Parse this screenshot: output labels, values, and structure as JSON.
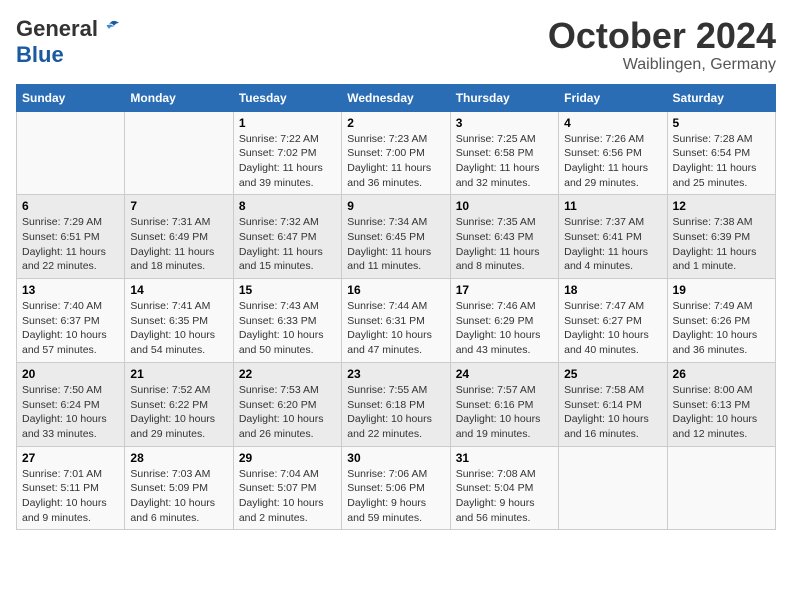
{
  "header": {
    "logo_line1": "General",
    "logo_line2": "Blue",
    "month": "October 2024",
    "location": "Waiblingen, Germany"
  },
  "weekdays": [
    "Sunday",
    "Monday",
    "Tuesday",
    "Wednesday",
    "Thursday",
    "Friday",
    "Saturday"
  ],
  "weeks": [
    [
      {
        "day": "",
        "info": ""
      },
      {
        "day": "",
        "info": ""
      },
      {
        "day": "1",
        "info": "Sunrise: 7:22 AM\nSunset: 7:02 PM\nDaylight: 11 hours and 39 minutes."
      },
      {
        "day": "2",
        "info": "Sunrise: 7:23 AM\nSunset: 7:00 PM\nDaylight: 11 hours and 36 minutes."
      },
      {
        "day": "3",
        "info": "Sunrise: 7:25 AM\nSunset: 6:58 PM\nDaylight: 11 hours and 32 minutes."
      },
      {
        "day": "4",
        "info": "Sunrise: 7:26 AM\nSunset: 6:56 PM\nDaylight: 11 hours and 29 minutes."
      },
      {
        "day": "5",
        "info": "Sunrise: 7:28 AM\nSunset: 6:54 PM\nDaylight: 11 hours and 25 minutes."
      }
    ],
    [
      {
        "day": "6",
        "info": "Sunrise: 7:29 AM\nSunset: 6:51 PM\nDaylight: 11 hours and 22 minutes."
      },
      {
        "day": "7",
        "info": "Sunrise: 7:31 AM\nSunset: 6:49 PM\nDaylight: 11 hours and 18 minutes."
      },
      {
        "day": "8",
        "info": "Sunrise: 7:32 AM\nSunset: 6:47 PM\nDaylight: 11 hours and 15 minutes."
      },
      {
        "day": "9",
        "info": "Sunrise: 7:34 AM\nSunset: 6:45 PM\nDaylight: 11 hours and 11 minutes."
      },
      {
        "day": "10",
        "info": "Sunrise: 7:35 AM\nSunset: 6:43 PM\nDaylight: 11 hours and 8 minutes."
      },
      {
        "day": "11",
        "info": "Sunrise: 7:37 AM\nSunset: 6:41 PM\nDaylight: 11 hours and 4 minutes."
      },
      {
        "day": "12",
        "info": "Sunrise: 7:38 AM\nSunset: 6:39 PM\nDaylight: 11 hours and 1 minute."
      }
    ],
    [
      {
        "day": "13",
        "info": "Sunrise: 7:40 AM\nSunset: 6:37 PM\nDaylight: 10 hours and 57 minutes."
      },
      {
        "day": "14",
        "info": "Sunrise: 7:41 AM\nSunset: 6:35 PM\nDaylight: 10 hours and 54 minutes."
      },
      {
        "day": "15",
        "info": "Sunrise: 7:43 AM\nSunset: 6:33 PM\nDaylight: 10 hours and 50 minutes."
      },
      {
        "day": "16",
        "info": "Sunrise: 7:44 AM\nSunset: 6:31 PM\nDaylight: 10 hours and 47 minutes."
      },
      {
        "day": "17",
        "info": "Sunrise: 7:46 AM\nSunset: 6:29 PM\nDaylight: 10 hours and 43 minutes."
      },
      {
        "day": "18",
        "info": "Sunrise: 7:47 AM\nSunset: 6:27 PM\nDaylight: 10 hours and 40 minutes."
      },
      {
        "day": "19",
        "info": "Sunrise: 7:49 AM\nSunset: 6:26 PM\nDaylight: 10 hours and 36 minutes."
      }
    ],
    [
      {
        "day": "20",
        "info": "Sunrise: 7:50 AM\nSunset: 6:24 PM\nDaylight: 10 hours and 33 minutes."
      },
      {
        "day": "21",
        "info": "Sunrise: 7:52 AM\nSunset: 6:22 PM\nDaylight: 10 hours and 29 minutes."
      },
      {
        "day": "22",
        "info": "Sunrise: 7:53 AM\nSunset: 6:20 PM\nDaylight: 10 hours and 26 minutes."
      },
      {
        "day": "23",
        "info": "Sunrise: 7:55 AM\nSunset: 6:18 PM\nDaylight: 10 hours and 22 minutes."
      },
      {
        "day": "24",
        "info": "Sunrise: 7:57 AM\nSunset: 6:16 PM\nDaylight: 10 hours and 19 minutes."
      },
      {
        "day": "25",
        "info": "Sunrise: 7:58 AM\nSunset: 6:14 PM\nDaylight: 10 hours and 16 minutes."
      },
      {
        "day": "26",
        "info": "Sunrise: 8:00 AM\nSunset: 6:13 PM\nDaylight: 10 hours and 12 minutes."
      }
    ],
    [
      {
        "day": "27",
        "info": "Sunrise: 7:01 AM\nSunset: 5:11 PM\nDaylight: 10 hours and 9 minutes."
      },
      {
        "day": "28",
        "info": "Sunrise: 7:03 AM\nSunset: 5:09 PM\nDaylight: 10 hours and 6 minutes."
      },
      {
        "day": "29",
        "info": "Sunrise: 7:04 AM\nSunset: 5:07 PM\nDaylight: 10 hours and 2 minutes."
      },
      {
        "day": "30",
        "info": "Sunrise: 7:06 AM\nSunset: 5:06 PM\nDaylight: 9 hours and 59 minutes."
      },
      {
        "day": "31",
        "info": "Sunrise: 7:08 AM\nSunset: 5:04 PM\nDaylight: 9 hours and 56 minutes."
      },
      {
        "day": "",
        "info": ""
      },
      {
        "day": "",
        "info": ""
      }
    ]
  ]
}
